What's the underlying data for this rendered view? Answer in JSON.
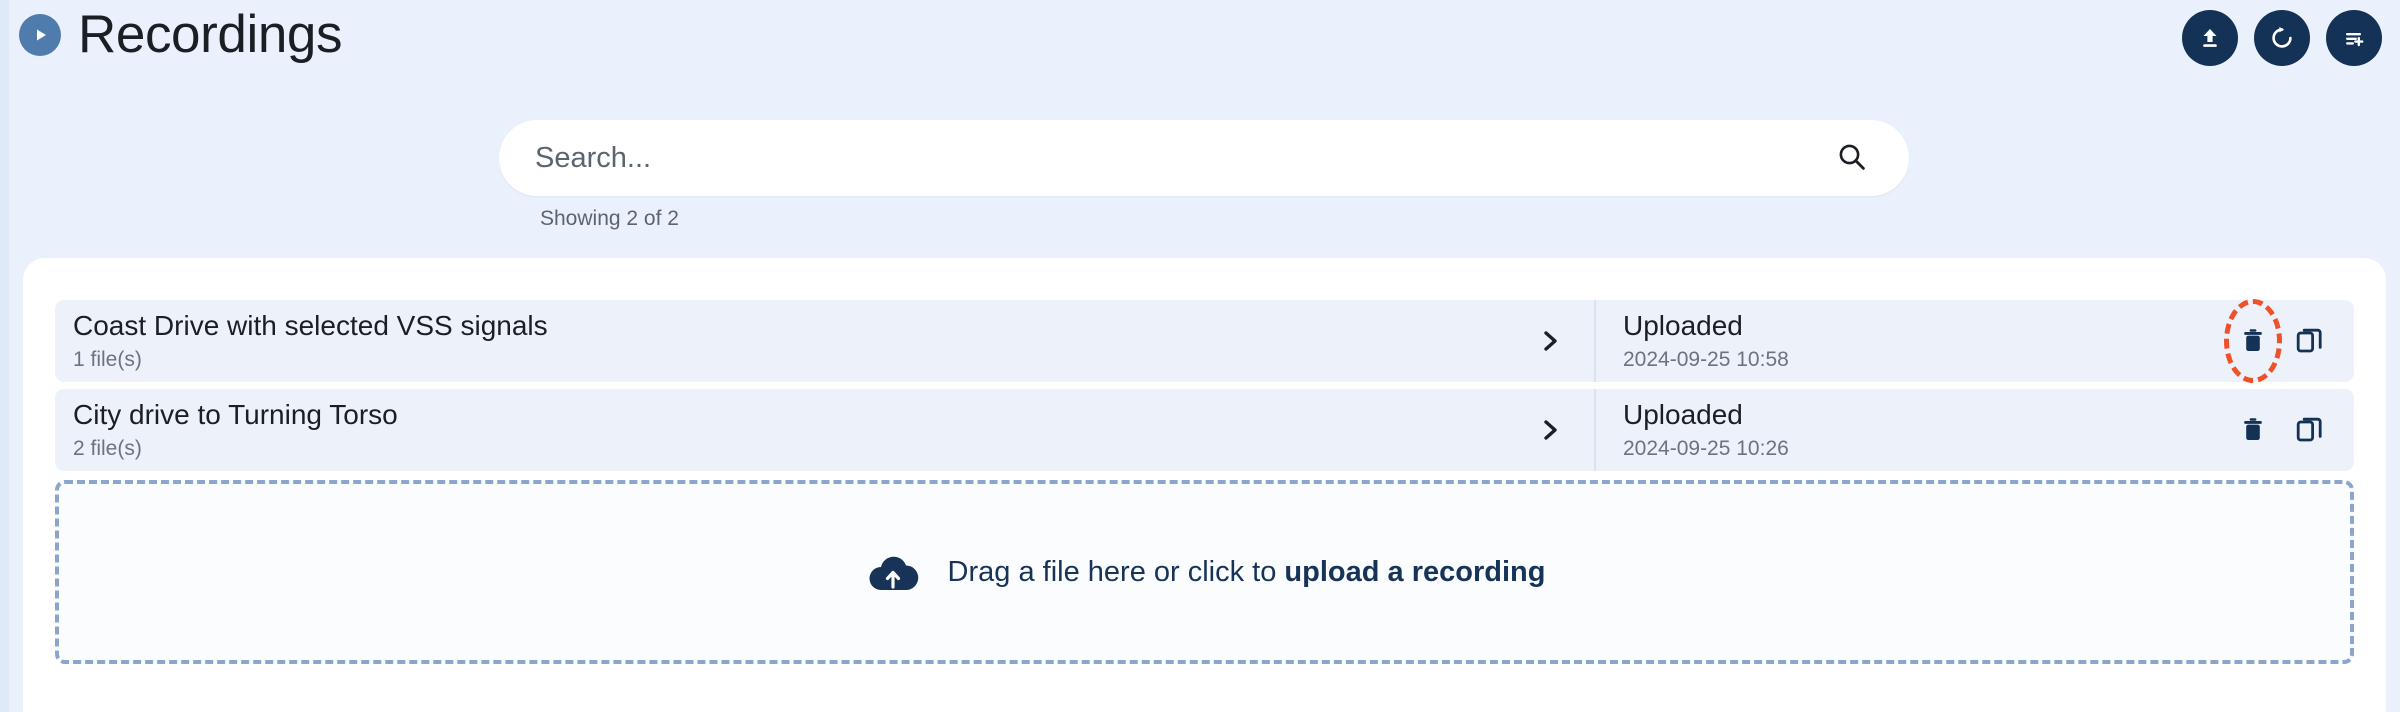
{
  "header": {
    "title": "Recordings",
    "logo_icon": "play-circle-icon",
    "actions": [
      {
        "name": "upload-button",
        "icon": "upload-icon",
        "label": "Upload"
      },
      {
        "name": "refresh-button",
        "icon": "refresh-icon",
        "label": "Refresh"
      },
      {
        "name": "add-to-list-button",
        "icon": "list-add-icon",
        "label": "Add to list"
      }
    ]
  },
  "search": {
    "value": "",
    "placeholder": "Search...",
    "icon": "search-icon",
    "showing_text": "Showing 2 of 2"
  },
  "recordings": [
    {
      "name": "Coast Drive with selected VSS signals",
      "files": "1 file(s)",
      "status": "Uploaded",
      "timestamp": "2024-09-25 10:58",
      "expand_icon": "chevron-right-icon",
      "delete_icon": "trash-icon",
      "copy_icon": "copy-icon",
      "highlighted": true
    },
    {
      "name": "City drive to Turning Torso",
      "files": "2 file(s)",
      "status": "Uploaded",
      "timestamp": "2024-09-25 10:26",
      "expand_icon": "chevron-right-icon",
      "delete_icon": "trash-icon",
      "copy_icon": "copy-icon",
      "highlighted": false
    }
  ],
  "dropzone": {
    "icon": "cloud-upload-icon",
    "text_prefix": "Drag a file here or click to ",
    "text_strong": "upload a recording"
  },
  "colors": {
    "page_background": "#eaf1fc",
    "card_background": "#ffffff",
    "row_background": "#edf2fa",
    "brand_dark": "#143256",
    "brand_medium": "#4f7bad",
    "annotation": "#f0502a",
    "dropzone_border": "#8aa6cd",
    "muted_text": "#6b737f"
  }
}
